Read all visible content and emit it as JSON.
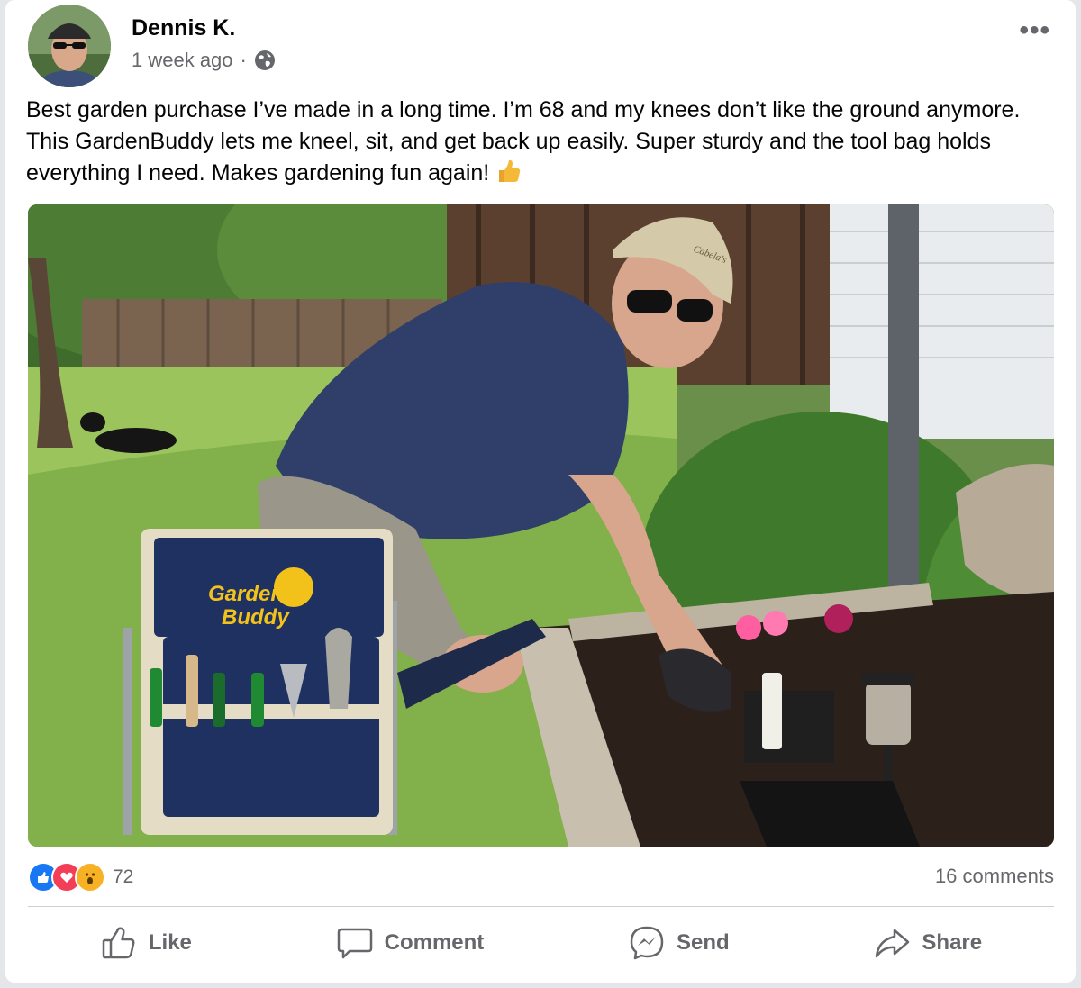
{
  "post": {
    "author": "Dennis K.",
    "timestamp": "1 week ago",
    "separator": "·",
    "text": "Best garden purchase I’ve made in a long time. I’m 68 and my knees don’t like the ground anymore. This GardenBuddy lets me kneel, sit, and get back up easily. Super sturdy and the tool bag holds everything I need. Makes gardening fun again!",
    "emoji": "thumbs-up-emoji",
    "photo": {
      "bag_logo_line1": "Garden",
      "bag_logo_line2": "Buddy",
      "cap_logo": "Cabela's"
    }
  },
  "reactions": {
    "icons": [
      "like-reaction-icon",
      "love-reaction-icon",
      "wow-reaction-icon"
    ],
    "count": "72",
    "comments": "16 comments"
  },
  "actions": {
    "like": "Like",
    "comment": "Comment",
    "send": "Send",
    "share": "Share"
  },
  "colors": {
    "like_blue": "#1877f2",
    "love_red": "#f33e58",
    "wow_yellow": "#f7b125",
    "secondary_text": "#65676b"
  }
}
